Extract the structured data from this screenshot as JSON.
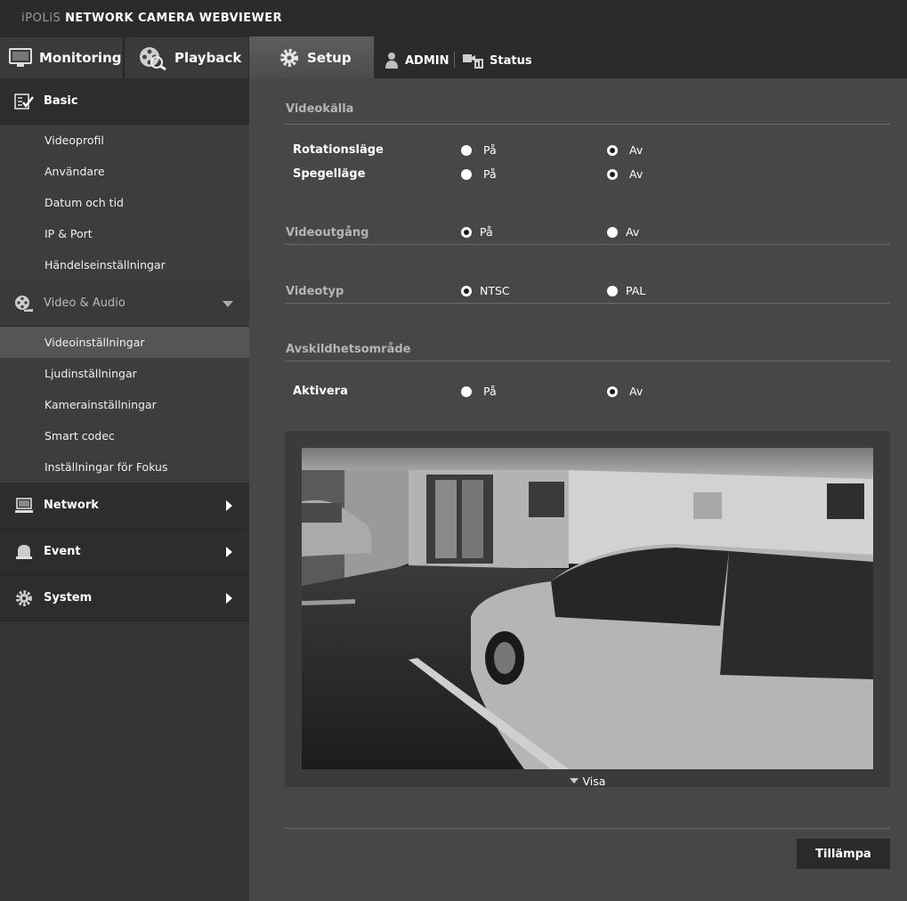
{
  "header": {
    "brand_prefix": "iPOLiS",
    "brand_rest": "NETWORK CAMERA WEBVIEWER",
    "tabs": [
      {
        "label": "Monitoring"
      },
      {
        "label": "Playback"
      },
      {
        "label": "Setup"
      }
    ],
    "user": "ADMIN",
    "status": "Status"
  },
  "sidebar": {
    "basic": {
      "label": "Basic",
      "items": [
        "Videoprofil",
        "Användare",
        "Datum och tid",
        "IP & Port",
        "Händelseinställningar"
      ]
    },
    "video_audio": {
      "label": "Video & Audio",
      "items": [
        "Videoinställningar",
        "Ljudinställningar",
        "Kamerainställningar",
        "Smart codec",
        "Inställningar för Fokus"
      ],
      "active_index": 0
    },
    "network": {
      "label": "Network"
    },
    "event": {
      "label": "Event"
    },
    "system": {
      "label": "System"
    }
  },
  "main": {
    "video_source": {
      "title": "Videokälla",
      "rotation": {
        "label": "Rotationsläge",
        "on": "På",
        "off": "Av",
        "selected": "off"
      },
      "mirror": {
        "label": "Spegelläge",
        "on": "På",
        "off": "Av",
        "selected": "off"
      }
    },
    "video_output": {
      "title": "Videoutgång",
      "on": "På",
      "off": "Av",
      "selected": "on"
    },
    "video_type": {
      "title": "Videotyp",
      "ntsc": "NTSC",
      "pal": "PAL",
      "selected": "ntsc"
    },
    "privacy": {
      "title": "Avskildhetsområde",
      "enable": {
        "label": "Aktivera",
        "on": "På",
        "off": "Av",
        "selected": "off"
      }
    },
    "preview": {
      "toggle_label": "Visa"
    },
    "apply_label": "Tillämpa"
  }
}
